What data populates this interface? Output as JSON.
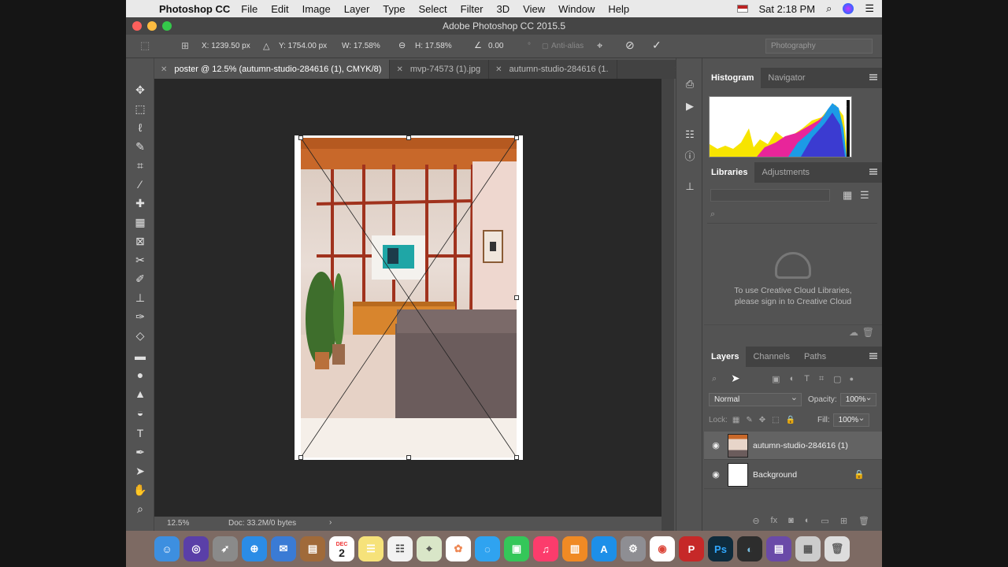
{
  "menubar": {
    "app": "Photoshop CC",
    "items": [
      "File",
      "Edit",
      "Image",
      "Layer",
      "Type",
      "Select",
      "Filter",
      "3D",
      "View",
      "Window",
      "Help"
    ],
    "clock": "Sat 2:18 PM"
  },
  "window": {
    "title": "Adobe Photoshop CC 2015.5"
  },
  "options": {
    "x": "X: 1239.50 px",
    "y": "Y: 1754.00 px",
    "w": "W: 17.58%",
    "h": "H: 17.58%",
    "angle": "0.00",
    "antialias": "Anti-alias",
    "workspace": "Photography"
  },
  "tabs": [
    {
      "label": "poster @ 12.5% (autumn-studio-284616 (1), CMYK/8)",
      "active": true
    },
    {
      "label": "mvp-74573 (1).jpg",
      "active": false
    },
    {
      "label": "autumn-studio-284616 (1.",
      "active": false
    }
  ],
  "status": {
    "zoom": "12.5%",
    "doc": "Doc: 33.2M/0 bytes"
  },
  "panels": {
    "histogram_tabs": [
      "Histogram",
      "Navigator"
    ],
    "library_tabs": [
      "Libraries",
      "Adjustments"
    ],
    "library_message_1": "To use Creative Cloud Libraries,",
    "library_message_2": "please sign in to Creative Cloud",
    "layers_tabs": [
      "Layers",
      "Channels",
      "Paths"
    ],
    "blend_mode": "Normal",
    "opacity_label": "Opacity:",
    "opacity": "100%",
    "lock_label": "Lock:",
    "fill_label": "Fill:",
    "fill": "100%",
    "layers": [
      {
        "name": "autumn-studio-284616 (1)",
        "selected": true
      },
      {
        "name": "Background",
        "selected": false,
        "locked": true
      }
    ]
  },
  "dock": {
    "photoshop_label": "Ps",
    "calendar_month": "DEC",
    "calendar_day": "2"
  }
}
